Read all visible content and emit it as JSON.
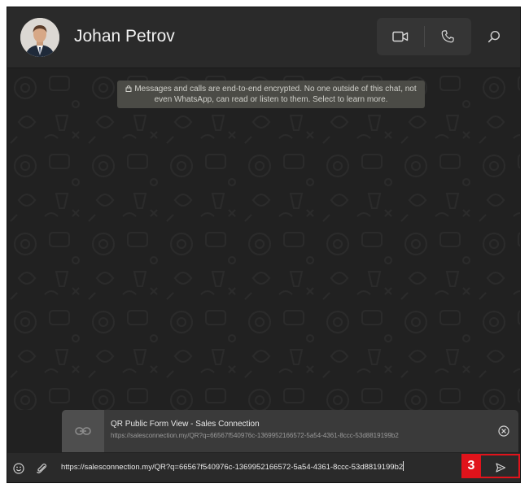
{
  "header": {
    "contact_name": "Johan Petrov",
    "icons": [
      "video-camera-icon",
      "phone-icon",
      "search-icon"
    ]
  },
  "chat": {
    "encryption_notice": "Messages and calls are end-to-end encrypted. No one outside of this chat, not even WhatsApp, can read or listen to them. Select to learn more."
  },
  "link_preview": {
    "title": "QR Public Form View - Sales Connection",
    "url": "https://salesconnection.my/QR?q=66567f540976c-1369952166572-5a54-4361-8ccc-53d8819199b2"
  },
  "composer": {
    "input_value": "https://salesconnection.my/QR?q=66567f540976c-1369952166572-5a54-4361-8ccc-53d8819199b2",
    "icons": [
      "emoji-icon",
      "attach-icon",
      "send-icon"
    ]
  },
  "annotation": {
    "step_number": "3",
    "color": "#e0131b"
  },
  "colors": {
    "background": "#212121",
    "header": "#2a2a2a",
    "notice_bg": "#4b4b46"
  }
}
